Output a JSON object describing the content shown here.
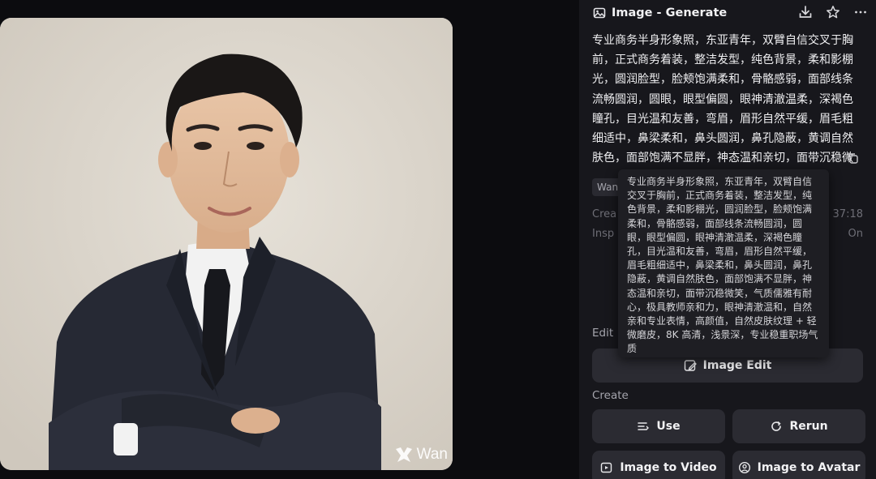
{
  "header": {
    "title": "Image - Generate"
  },
  "prompt": {
    "text": "专业商务半身形象照，东亚青年，双臂自信交叉于胸前，正式商务着装，整洁发型，纯色背景，柔和影棚光，圆润脸型，脸颊饱满柔和，骨骼感弱，面部线条流畅圆润，圆眼，眼型偏圆，眼神清澈温柔，深褐色瞳孔，目光温和友善，弯眉，眉形自然平缓，眉毛粗细适中，鼻梁柔和，鼻头圆润，鼻孔隐蔽，黄调自然肤色，面部饱满不显胖，神态温和亲切，面带沉稳微笑，气质儒雅有耐心，极具..."
  },
  "tooltip": {
    "text": "专业商务半身形象照，东亚青年，双臂自信交叉于胸前，正式商务着装，整洁发型，纯色背景，柔和影棚光，圆润脸型，脸颊饱满柔和，骨骼感弱，面部线条流畅圆润，圆眼，眼型偏圆，眼神清澈温柔，深褐色瞳孔，目光温和友善，弯眉，眉形自然平缓，眉毛粗细适中，鼻梁柔和，鼻头圆润，鼻孔隐蔽，黄调自然肤色，面部饱满不显胖，神态温和亲切，面带沉稳微笑，气质儒雅有耐心，极具教师亲和力，眼神清澈温和，自然亲和专业表情，高颜值，自然皮肤纹理 + 轻微磨皮，8K 高清，浅景深，专业稳重职场气质"
  },
  "meta": {
    "tag": "Wan",
    "created_label": "Crea",
    "created_value": "37:18",
    "inspire_label": "Insp",
    "inspire_value": "On"
  },
  "edit": {
    "label": "Edit",
    "image_edit": "Image Edit"
  },
  "create": {
    "label": "Create",
    "use": "Use",
    "rerun": "Rerun",
    "image_to_video": "Image to Video",
    "image_to_avatar": "Image to Avatar"
  },
  "watermark": {
    "text": "Wan"
  },
  "icons": {
    "header": "image-icon",
    "download": "download-icon",
    "star": "star-icon",
    "more": "more-icon",
    "copy": "copy-icon"
  }
}
